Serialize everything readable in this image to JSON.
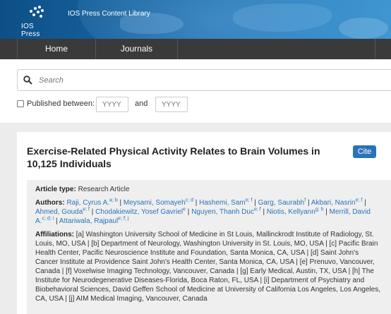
{
  "header": {
    "logo_text": "IOS Press",
    "library_title": "IOS Press Content Library"
  },
  "nav": {
    "home": "Home",
    "journals": "Journals"
  },
  "search": {
    "placeholder": "Search",
    "published_between_label": "Published between:",
    "year_from_placeholder": "YYYY",
    "and_label": "and",
    "year_to_placeholder": "YYYY"
  },
  "article": {
    "title": "Exercise-Related Physical Activity Relates to Brain Volumes in 10,125 Individuals",
    "cite_label": "Cite",
    "article_type_label": "Article type:",
    "article_type": "Research Article",
    "authors_label": "Authors:",
    "authors": [
      {
        "name": "Raji, Cyrus A.",
        "sup": "a; b"
      },
      {
        "name": "Meysami, Somayeh",
        "sup": "c; d"
      },
      {
        "name": "Hashemi, Sam",
        "sup": "e; f"
      },
      {
        "name": "Garg, Saurabh",
        "sup": "f"
      },
      {
        "name": "Akbari, Nasrin",
        "sup": "e; f"
      },
      {
        "name": "Ahmed, Gouda",
        "sup": "e; f"
      },
      {
        "name": "Chodakiewitz, Yosef Gavriel",
        "sup": "e"
      },
      {
        "name": "Nguyen, Thanh Duc",
        "sup": "e; f"
      },
      {
        "name": "Niotis, Kellyann",
        "sup": "g; h"
      },
      {
        "name": "Merrill, David A.",
        "sup": "c; d; i"
      },
      {
        "name": "Attariwala, Rajpaul",
        "sup": "e; f; j"
      }
    ],
    "affiliations_label": "Affiliations:",
    "affiliations": "[a] Washington University School of Medicine in St Louis, Mallinckrodt Institute of Radiology, St. Louis, MO, USA | [b] Department of Neurology, Washington University in St. Louis, MO, USA | [c] Pacific Brain Health Center, Pacific Neuroscience Institute and Foundation, Santa Monica, CA, USA | [d] Saint John's Cancer Institute at Providence Saint John's Health Center, Santa Monica, CA, USA | [e] Prenuvo, Vancouver, Canada | [f] Voxelwise Imaging Technology, Vancouver, Canada | [g] Early Medical, Austin, TX, USA | [h] The Institute for Neurodegenerative Diseases-Florida, Boca Raton, FL, USA | [i] Department of Psychiatry and Biobehavioral Sciences, David Geffen School of Medicine at University of California Los Angeles, Los Angeles, CA, USA | [j] AIM Medical Imaging, Vancouver, Canada"
  }
}
